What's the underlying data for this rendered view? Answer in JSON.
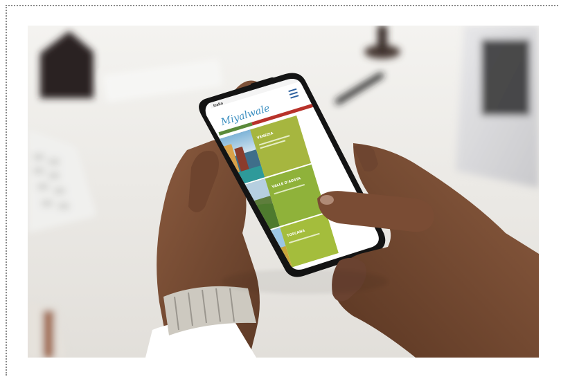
{
  "photo": {
    "description_free": true,
    "colors": {
      "desk": "#eceae6",
      "skin": "#7a4a32",
      "phone_frame": "#1a1a1a",
      "panel_green": "#a8b840",
      "nav_red": "#b8322a",
      "nav_green": "#5a8a3a",
      "watch": "#c8c4bc"
    },
    "phone_screen": {
      "brand_logo_text": "Miyalwale",
      "header_left_text": "Italia",
      "tiles": [
        {
          "label": "VENEZIA",
          "image": "canal-town",
          "panel": "#a6b63f"
        },
        {
          "label": "VALLE D'AOSTA",
          "image": "tower-mountains",
          "panel": "#8fb23a"
        },
        {
          "label": "TOSCANA",
          "image": "cypress-field",
          "panel": "#a4bd3c"
        }
      ]
    }
  }
}
